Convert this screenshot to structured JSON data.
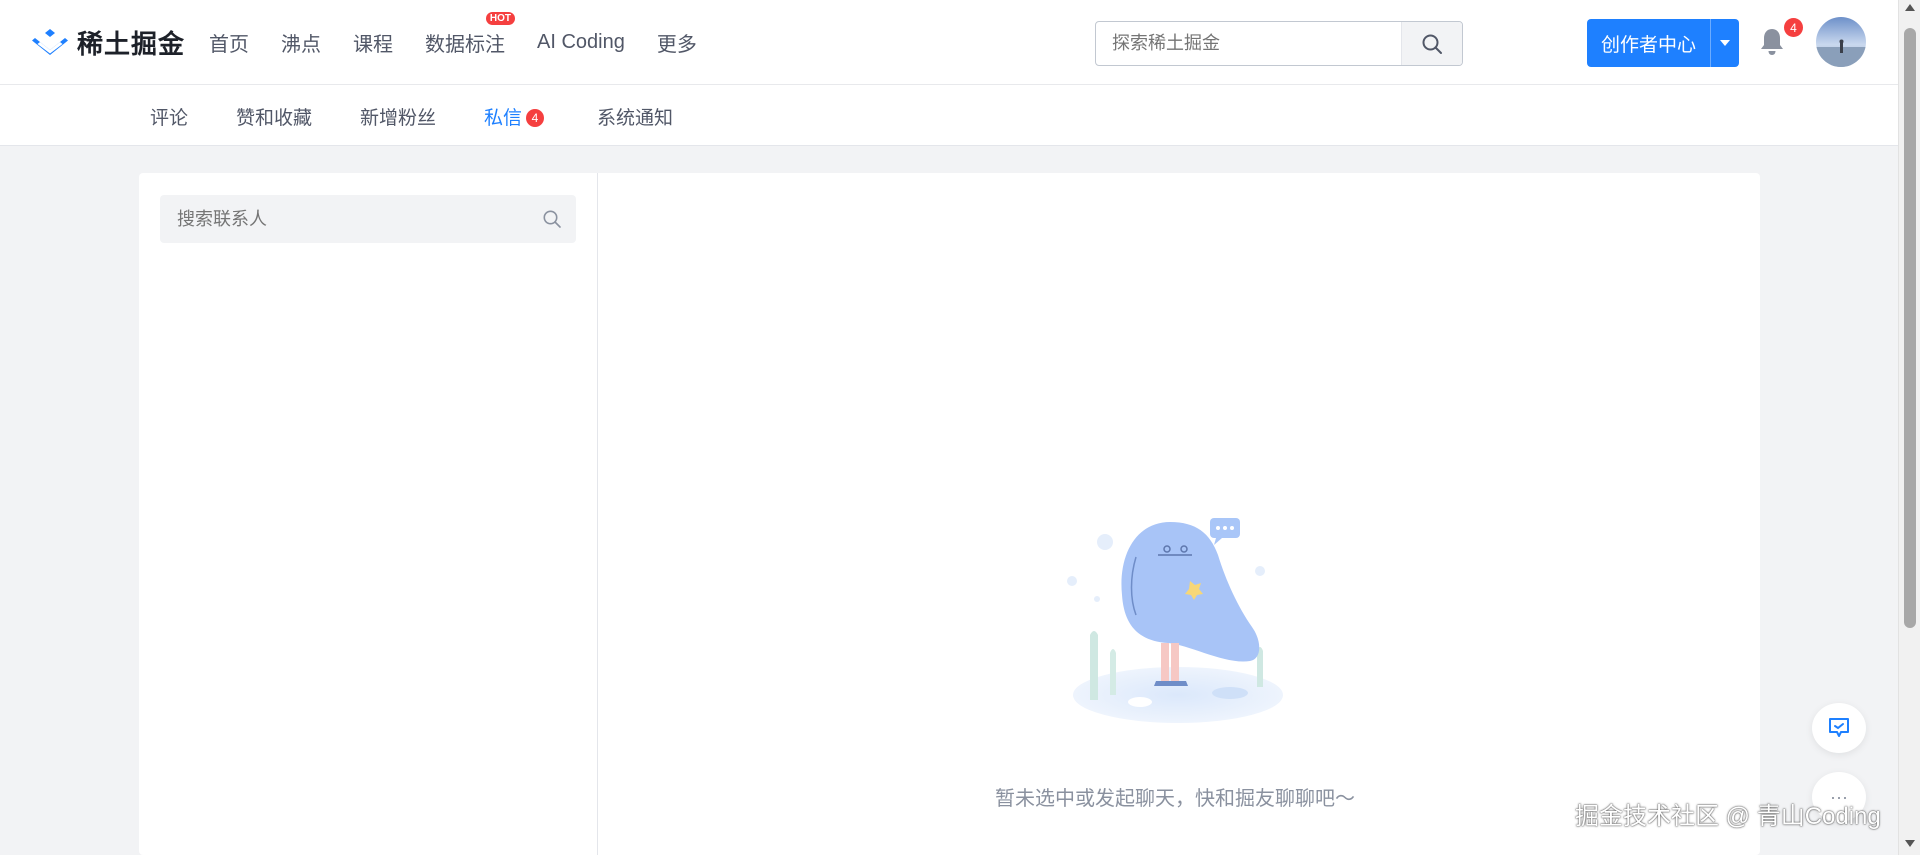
{
  "header": {
    "logo_text": "稀土掘金",
    "nav": [
      {
        "label": "首页"
      },
      {
        "label": "沸点"
      },
      {
        "label": "课程"
      },
      {
        "label": "数据标注",
        "badge": "HOT"
      },
      {
        "label": "AI Coding"
      },
      {
        "label": "更多"
      }
    ],
    "search": {
      "placeholder": "探索稀土掘金",
      "value": ""
    },
    "creator_button": "创作者中心",
    "notification_count": "4",
    "brand_color": "#1e80ff"
  },
  "subnav": {
    "items": [
      {
        "label": "评论"
      },
      {
        "label": "赞和收藏"
      },
      {
        "label": "新增粉丝"
      },
      {
        "label": "私信",
        "badge": "4",
        "active": true
      },
      {
        "label": "系统通知"
      }
    ]
  },
  "contacts": {
    "search_placeholder": "搜索联系人"
  },
  "chat": {
    "empty_text": "暂未选中或发起聊天，快和掘友聊聊吧～"
  },
  "watermark": "掘金技术社区 @ 青山Coding",
  "float_more": "···"
}
